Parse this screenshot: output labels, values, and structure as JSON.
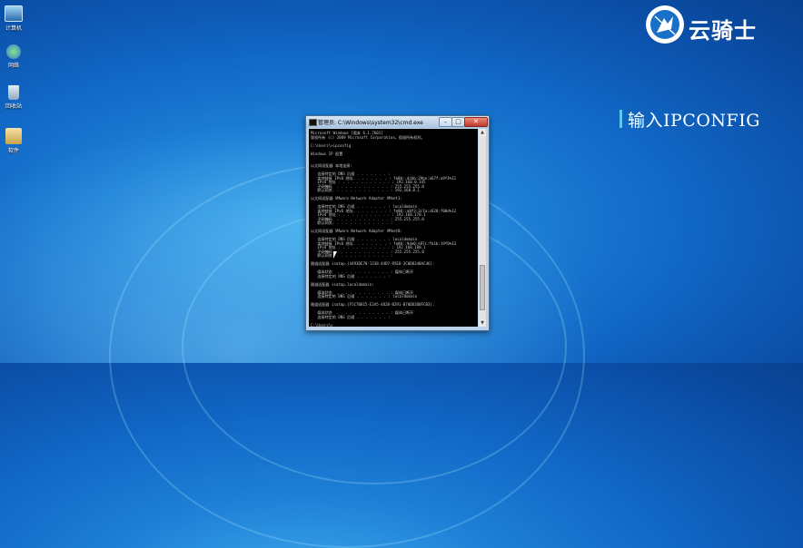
{
  "desktop": {
    "icons": [
      {
        "label": "计算机",
        "icon": "computer-icon"
      },
      {
        "label": "网络",
        "icon": "network-icon"
      },
      {
        "label": "回收站",
        "icon": "recycle-bin-icon"
      },
      {
        "label": "软件",
        "icon": "folder-icon"
      }
    ]
  },
  "brand": {
    "name": "云骑士"
  },
  "caption": {
    "text": "输入IPCONFIG"
  },
  "cmd_window": {
    "title": "管理员: C:\\Windows\\system32\\cmd.exe",
    "buttons": {
      "minimize": "–",
      "maximize": "□",
      "close": "✕"
    },
    "lines": [
      "Microsoft Windows [版本 6.1.7601]",
      "版权所有 (c) 2009 Microsoft Corporation。保留所有权利。",
      "",
      "C:\\Users\\>ipconfig",
      "",
      "Windows IP 配置",
      "",
      "",
      "以太网适配器 本地连接:",
      "",
      "   连接特定的 DNS 后缀 . . . . . . . :",
      "   本地链接 IPv6 地址. . . . . . . . : fe80::dcbb:29be:a67f:a9f4%11",
      "   IPv4 地址 . . . . . . . . . . . . : 192.168.0.145",
      "   子网掩码  . . . . . . . . . . . . : 255.255.255.0",
      "   默认网关. . . . . . . . . . . . . : 192.168.0.1",
      "",
      "以太网适配器 VMware Network Adapter VMnet1:",
      "",
      "   连接特定的 DNS 后缀 . . . . . . . : localdomain",
      "   本地链接 IPv6 地址. . . . . . . . : fe80::a8f3:3c7a:c628:f00d%12",
      "   IPv4 地址 . . . . . . . . . . . . : 192.168.170.1",
      "   子网掩码  . . . . . . . . . . . . : 255.255.255.0",
      "   默认网关. . . . . . . . . . . . . :",
      "",
      "以太网适配器 VMware Network Adapter VMnet8:",
      "",
      "   连接特定的 DNS 后缀 . . . . . . . : localdomain",
      "   本地链接 IPv6 地址. . . . . . . . : fe80::9de0:e97c:fb1b:19f0%13",
      "   IPv4 地址 . . . . . . . . . . . . : 192.168.180.1",
      "   子网掩码  . . . . . . . . . . . . : 255.255.255.0",
      "   默认网关. . . . . . . . . . . . . :",
      "",
      "隧道适配器 isatap.{4493DE70-1338-44D7-95E8-3C0D8348AC46}:",
      "",
      "   媒体状态  . . . . . . . . . . . . : 媒体已断开",
      "   连接特定的 DNS 后缀 . . . . . . . :",
      "",
      "隧道适配器 isatap.localdomain:",
      "",
      "   媒体状态  . . . . . . . . . . . . : 媒体已断开",
      "   连接特定的 DNS 后缀 . . . . . . . : localdomain",
      "",
      "隧道适配器 isatap.{F5C7B815-E2A5-4828-B291-B70DD3D0FCB3}:",
      "",
      "   媒体状态  . . . . . . . . . . . . : 媒体已断开",
      "   连接特定的 DNS 后缀 . . . . . . . :",
      "",
      "C:\\Users\\>"
    ]
  }
}
